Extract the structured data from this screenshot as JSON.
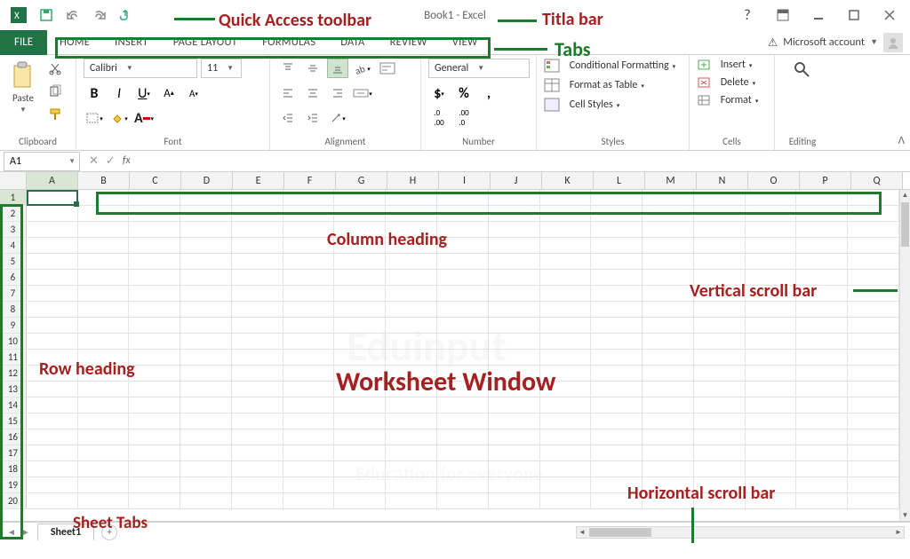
{
  "title": "Book1 - Excel",
  "qat_icons": [
    "excel-logo",
    "save",
    "undo",
    "redo",
    "touch-mode"
  ],
  "window_icons": [
    "help",
    "ribbon-display",
    "minimize",
    "maximize",
    "close"
  ],
  "filetab": "FILE",
  "tabs": [
    "HOME",
    "INSERT",
    "PAGE LAYOUT",
    "FORMULAS",
    "DATA",
    "REVIEW",
    "VIEW"
  ],
  "msaccount": {
    "warn": "⚠",
    "label": "Microsoft account"
  },
  "ribbon": {
    "clipboard": {
      "paste": "Paste",
      "label": "Clipboard"
    },
    "font": {
      "name": "Calibri",
      "size": "11",
      "label": "Font"
    },
    "alignment": {
      "label": "Alignment"
    },
    "number": {
      "format": "General",
      "label": "Number"
    },
    "styles": {
      "conditional": "Conditional Formatting",
      "astable": "Format as Table",
      "cellstyles": "Cell Styles",
      "label": "Styles"
    },
    "cells": {
      "insert": "Insert",
      "delete": "Delete",
      "format": "Format",
      "label": "Cells"
    },
    "editing": {
      "label": "Editing"
    }
  },
  "namebox": "A1",
  "fx": "fx",
  "columns": [
    "A",
    "B",
    "C",
    "D",
    "E",
    "F",
    "G",
    "H",
    "I",
    "J",
    "K",
    "L",
    "M",
    "N",
    "O",
    "P",
    "Q"
  ],
  "rows": [
    "1",
    "2",
    "3",
    "4",
    "5",
    "6",
    "7",
    "8",
    "9",
    "10",
    "11",
    "12",
    "13",
    "14",
    "15",
    "16",
    "17",
    "18",
    "19",
    "20"
  ],
  "sheet": {
    "name": "Sheet1",
    "add": "+"
  },
  "annotations": {
    "qat": "Quick Access toolbar",
    "titlebar": "Titla bar",
    "tabs": "Tabs",
    "colhead": "Column heading",
    "rowhead": "Row heading",
    "worksheet": "Worksheet Window",
    "vscroll": "Vertical scroll bar",
    "hscroll": "Horizontal scroll bar",
    "sheettabs": "Sheet Tabs"
  },
  "watermark": {
    "brand": "Eduinput",
    "tag": "Education for everyone"
  }
}
